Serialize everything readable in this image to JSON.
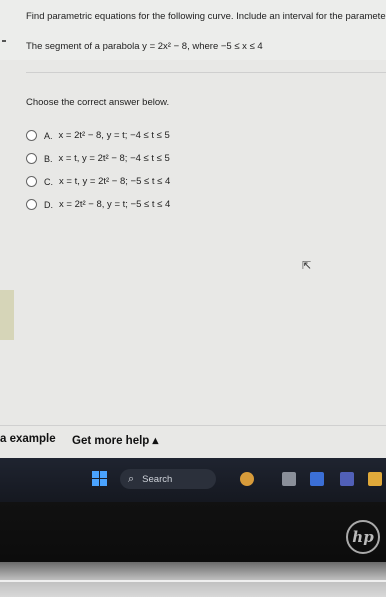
{
  "question": {
    "instruction": "Find parametric equations for the following curve. Include an interval for the paramete",
    "subtext": "The segment of a parabola y = 2x² − 8, where −5 ≤ x ≤ 4",
    "prompt": "Choose the correct answer below."
  },
  "options": [
    {
      "letter": "A.",
      "text": "x = 2t² − 8, y = t; −4 ≤ t ≤ 5"
    },
    {
      "letter": "B.",
      "text": "x = t, y = 2t² − 8; −4 ≤ t ≤ 5"
    },
    {
      "letter": "C.",
      "text": "x = t, y = 2t² − 8; −5 ≤ t ≤ 4"
    },
    {
      "letter": "D.",
      "text": "x = 2t² − 8, y = t; −5 ≤ t ≤ 4"
    }
  ],
  "footer": {
    "example_label": "a example",
    "help_label": "Get more help ▴"
  },
  "taskbar": {
    "search_label": "Search"
  },
  "device": {
    "logo_text": "hp"
  },
  "colors": {
    "windows_accent": "#4aa3ff",
    "taskbar_bg": "#1a1e28"
  },
  "icons": [
    "search-icon",
    "windows-start-icon",
    "cursor-icon",
    "radio-icon"
  ]
}
